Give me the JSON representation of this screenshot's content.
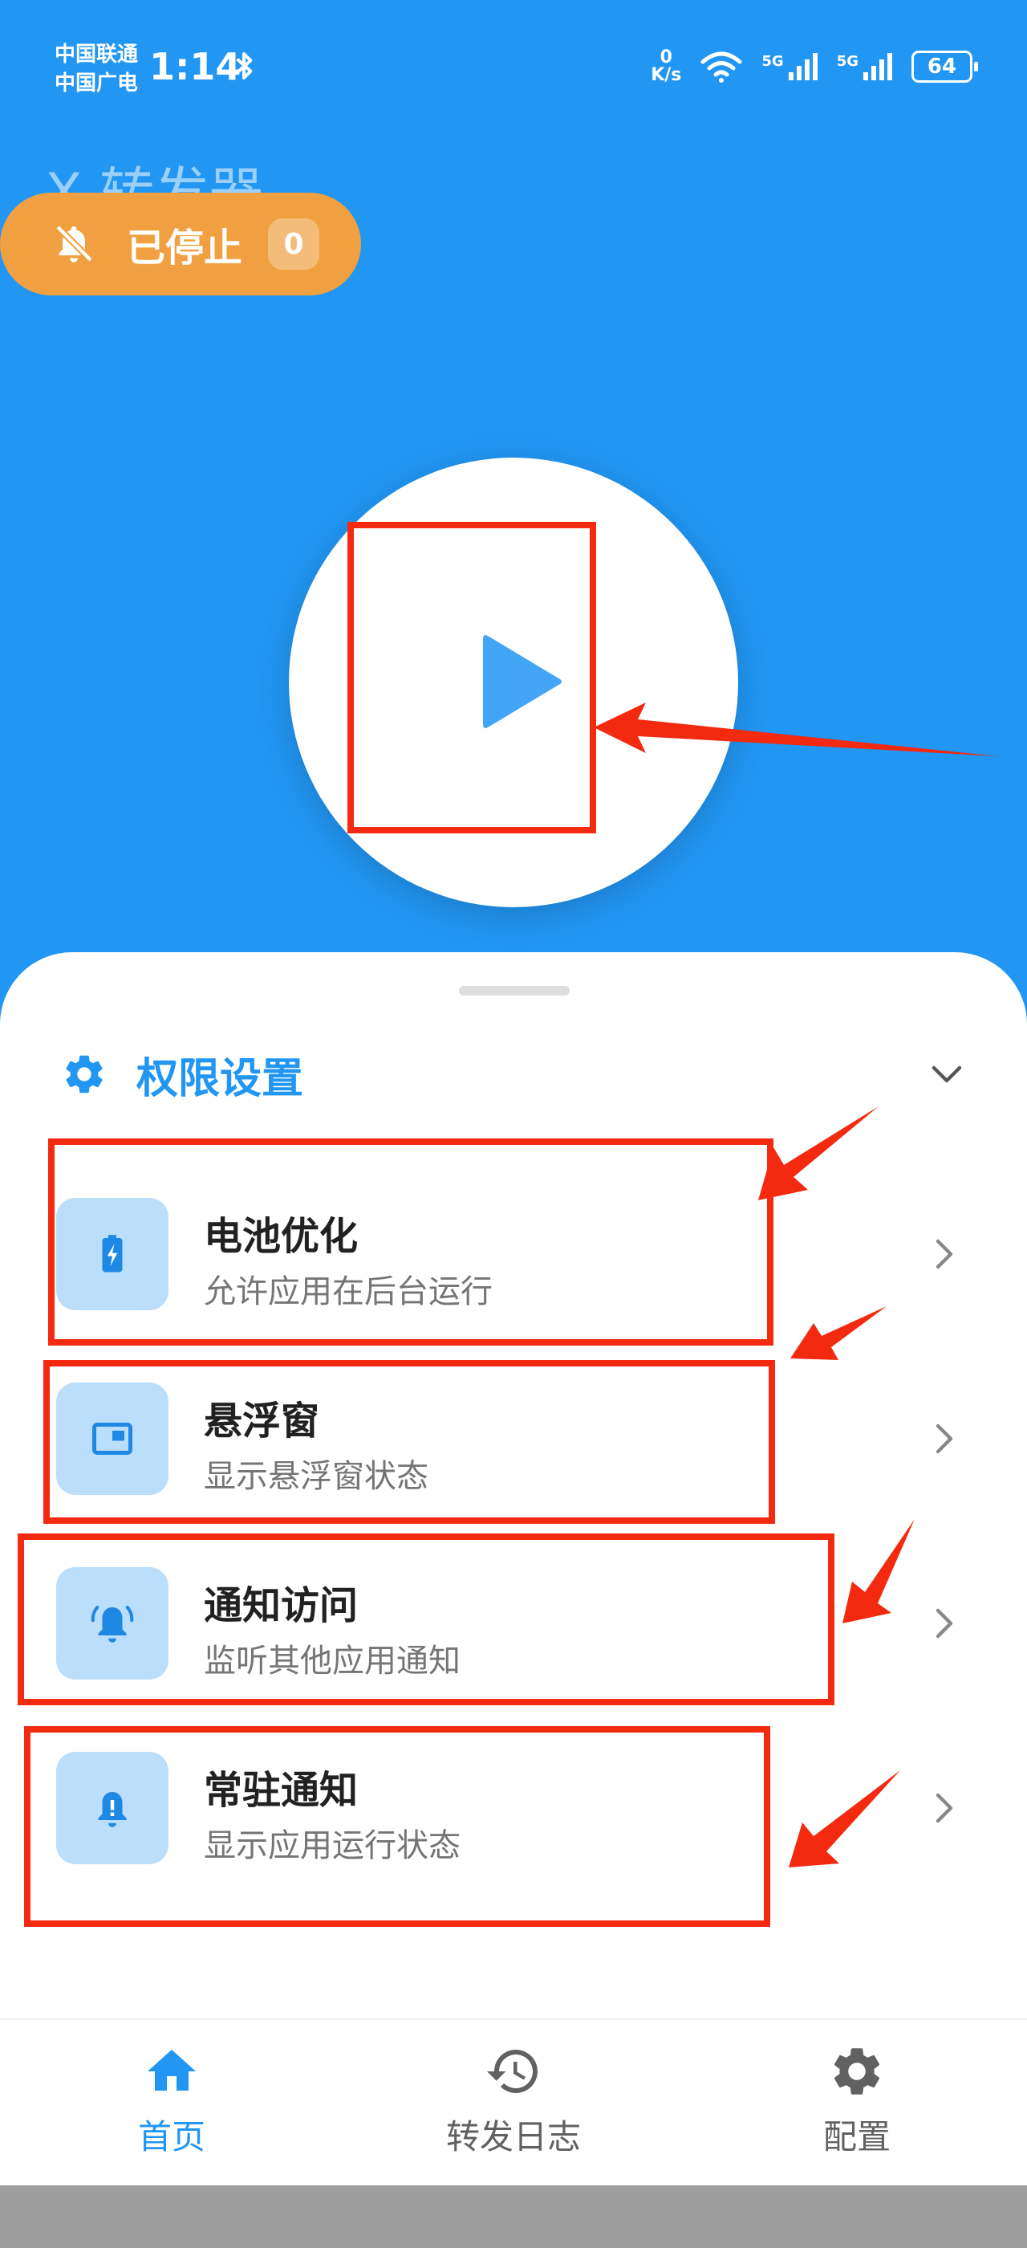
{
  "status_bar": {
    "carrier_1": "中国联通",
    "carrier_2": "中国广电",
    "time": "1:14",
    "net_speed_value": "0",
    "net_speed_unit": "K/s",
    "signal_1_label": "5G",
    "signal_2_label": "5G",
    "battery": "64"
  },
  "header": {
    "app_title": "X 转发器",
    "status_label": "已停止",
    "status_count": "0"
  },
  "sheet": {
    "section_title": "权限设置",
    "items": [
      {
        "title": "电池优化",
        "desc": "允许应用在后台运行",
        "icon": "battery-icon"
      },
      {
        "title": "悬浮窗",
        "desc": "显示悬浮窗状态",
        "icon": "floating-window-icon"
      },
      {
        "title": "通知访问",
        "desc": "监听其他应用通知",
        "icon": "notification-ring-icon"
      },
      {
        "title": "常驻通知",
        "desc": "显示应用运行状态",
        "icon": "persistent-notification-icon"
      }
    ]
  },
  "bottom_nav": {
    "home": "首页",
    "logs": "转发日志",
    "config": "配置"
  },
  "colors": {
    "primary": "#2196F3",
    "status_pill": "#F0A040",
    "icon_bg": "#BBDEFB",
    "annotation": "#F32A10"
  }
}
